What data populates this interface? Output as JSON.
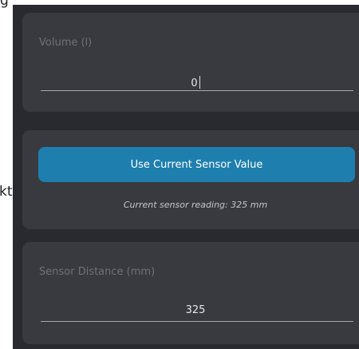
{
  "background_fragments": {
    "top_edge_text": "g",
    "left_edge_text": "kt"
  },
  "volume_card": {
    "label": "Volume (l)",
    "value": "0"
  },
  "sensor_action_card": {
    "button_label": "Use Current Sensor Value",
    "reading_text": "Current sensor reading: 325 mm"
  },
  "distance_card": {
    "label": "Sensor Distance (mm)",
    "value": "325"
  },
  "colors": {
    "dialog_background": "#282a30",
    "card_background": "#383a40",
    "accent_button": "#1e7fae"
  }
}
